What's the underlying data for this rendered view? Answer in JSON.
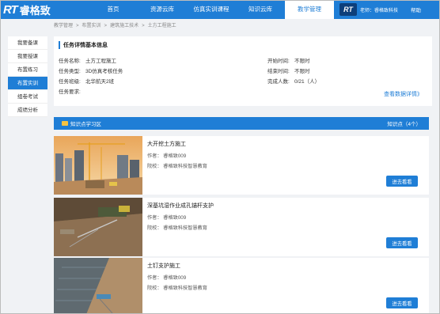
{
  "brand": {
    "logo_rt": "RT",
    "logo_cn": "睿格致"
  },
  "nav": [
    {
      "label": "首页"
    },
    {
      "label": "资源云库"
    },
    {
      "label": "仿真实训课程"
    },
    {
      "label": "知识云库"
    },
    {
      "label": "教学管理"
    }
  ],
  "user": {
    "logo": "RT",
    "name": "老师：睿格致科技",
    "help": "帮助"
  },
  "breadcrumb": [
    "教学管理",
    "布置实训",
    "建筑施工技术",
    "土方工程施工"
  ],
  "sidebar": [
    {
      "label": "我要备课"
    },
    {
      "label": "我要授课"
    },
    {
      "label": "布置练习"
    },
    {
      "label": "布置实训"
    },
    {
      "label": "组卷考试"
    },
    {
      "label": "成绩分析"
    }
  ],
  "task": {
    "title": "任务详情基本信息",
    "name_k": "任务名称:",
    "name_v": "土方工程施工",
    "type_k": "任务类型:",
    "type_v": "3D仿真考核任务",
    "class_k": "任务班级:",
    "class_v": "北华航天2班",
    "req_k": "任务要求:",
    "req_v": "",
    "start_k": "开始时间:",
    "start_v": "不限时",
    "end_k": "结束时间:",
    "end_v": "不限时",
    "done_k": "完成人数:",
    "done_v": "0/21（人）",
    "detail_link": "查看数据详情》"
  },
  "knowledge": {
    "title": "知识点学习区",
    "count": "知识点（4个）"
  },
  "courses": [
    {
      "title": "大开挖土方施工",
      "author": "作者：  睿格致009",
      "school": "院校：  睿格致科技智慧教育",
      "button": "进去看看"
    },
    {
      "title": "深基坑湿作业成孔锚杆支护",
      "author": "作者：  睿格致009",
      "school": "院校：  睿格致科技智慧教育",
      "button": "进去看看"
    },
    {
      "title": "土钉支护施工",
      "author": "作者：  睿格致009",
      "school": "院校：  睿格致科技智慧教育",
      "button": "进去看看"
    }
  ],
  "colors": {
    "primary": "#1f7ed6",
    "page_bg": "#f0f2f5"
  }
}
